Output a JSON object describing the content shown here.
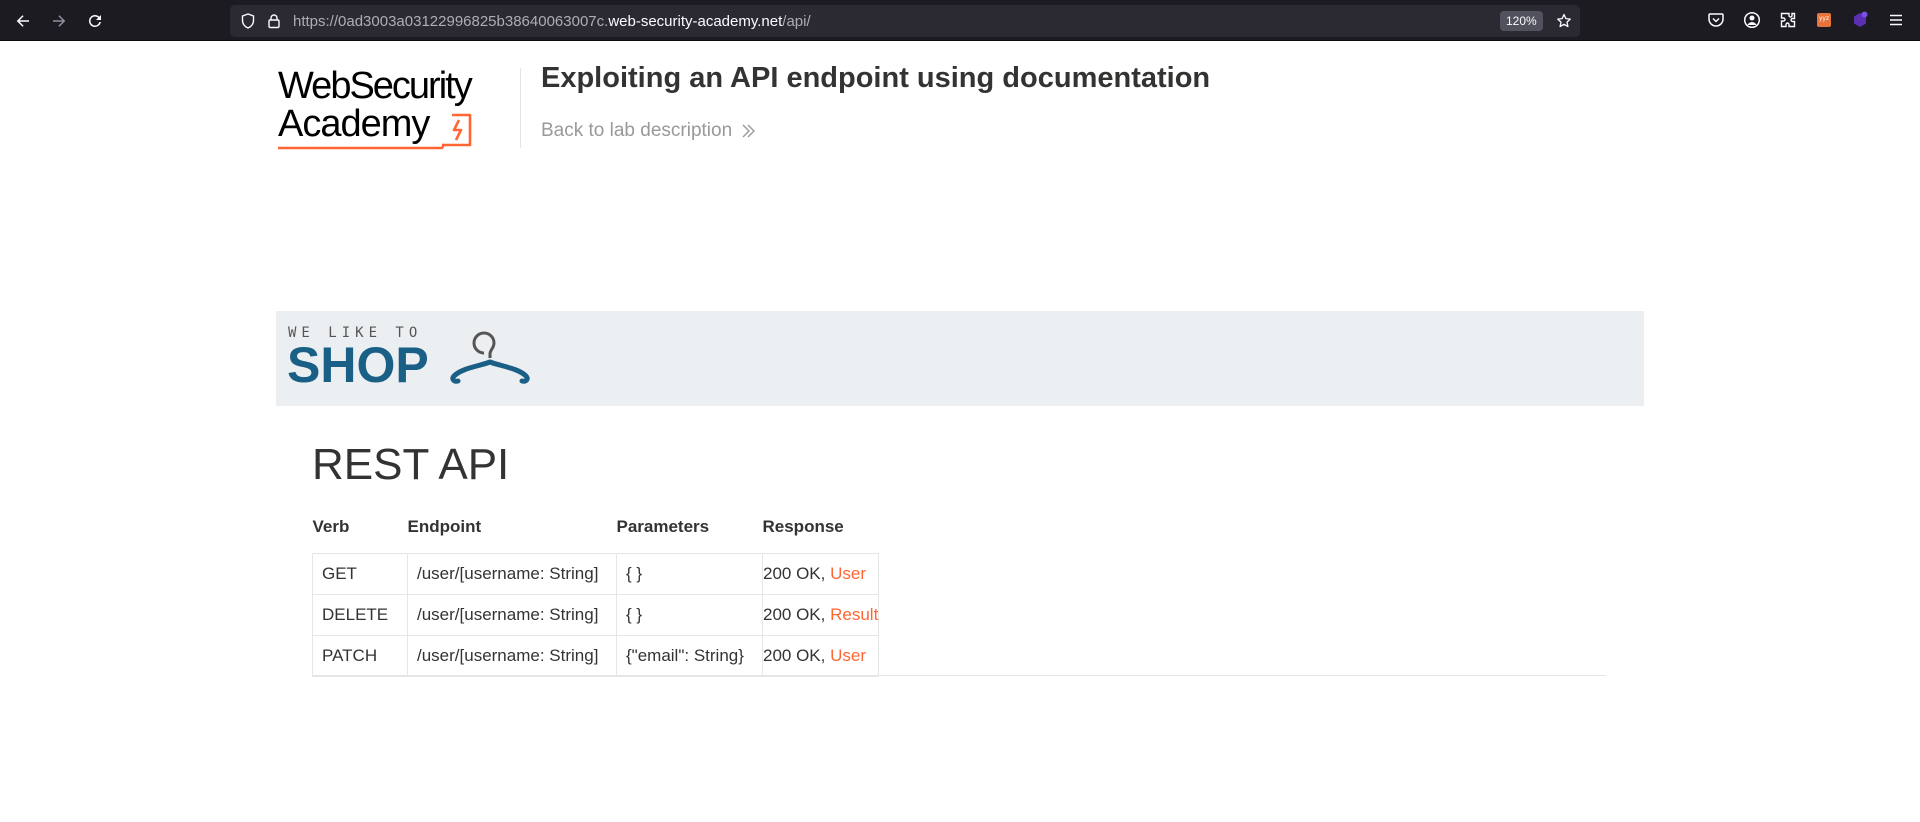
{
  "browser": {
    "url_prefix": "https://0ad3003a03122996825b38640063007c.",
    "url_host": "web-security-academy.net",
    "url_path": "/api/",
    "zoom": "120%",
    "icons": [
      "back-icon",
      "forward-icon",
      "reload-icon",
      "shield-icon",
      "lock-icon",
      "star-icon",
      "pocket-icon",
      "account-icon",
      "extensions-icon",
      "extension-badge-icon",
      "extension-purple-icon",
      "menu-icon"
    ]
  },
  "lab": {
    "logo_line1": "WebSecurity",
    "logo_line2": "Academy",
    "title": "Exploiting an API endpoint using documentation",
    "back_label": "Back to lab description"
  },
  "shop": {
    "tagline": "WE LIKE TO",
    "name": "SHOP"
  },
  "page": {
    "heading": "REST API"
  },
  "table": {
    "headers": [
      "Verb",
      "Endpoint",
      "Parameters",
      "Response"
    ],
    "rows": [
      {
        "verb": "GET",
        "endpoint": "/user/[username: String]",
        "params": "{ }",
        "status": "200 OK, ",
        "type": "User"
      },
      {
        "verb": "DELETE",
        "endpoint": "/user/[username: String]",
        "params": "{ }",
        "status": "200 OK, ",
        "type": "Result"
      },
      {
        "verb": "PATCH",
        "endpoint": "/user/[username: String]",
        "params": "{\"email\": String}",
        "status": "200 OK, ",
        "type": "User"
      }
    ]
  },
  "colors": {
    "accent": "#ff6633",
    "shop_blue": "#1a5f86",
    "banner_bg": "#ebeff1",
    "chrome_bg": "#1c1b22"
  }
}
